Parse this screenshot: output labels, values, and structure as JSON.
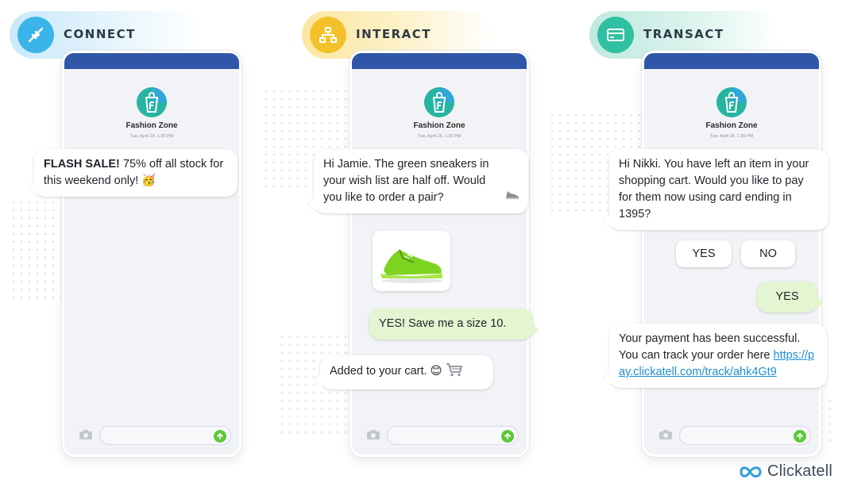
{
  "colors": {
    "connect": "#3bb4ea",
    "interact": "#f3c22b",
    "transact": "#2fc0a3",
    "phone_header": "#2f56a8",
    "outgoing": "#e4f5d1",
    "link": "#1f8fd0",
    "send": "#5dc93a"
  },
  "brand": {
    "name": "Fashion Zone",
    "timestamp": "Tue, April 18, 1.30 PM"
  },
  "panels": [
    {
      "phase": "CONNECT",
      "icon": "plug-icon",
      "messages": {
        "flash_bold": "FLASH SALE!",
        "flash_text": " 75% off all stock for this weekend only! ",
        "flash_emoji": "🥳"
      }
    },
    {
      "phase": "INTERACT",
      "icon": "network-icon",
      "messages": {
        "greeting": "Hi Jamie. The green sneakers in your wish list are half off. Would you like to order a pair?",
        "reply": "YES! Save me a size 10.",
        "confirm": "Added to your cart.",
        "confirm_emoji": "😊"
      }
    },
    {
      "phase": "TRANSACT",
      "icon": "credit-card-icon",
      "messages": {
        "prompt": "Hi Nikki. You have left an item in your shopping cart. Would you like to pay for them now using card ending in 1395?",
        "quick_yes": "YES",
        "quick_no": "NO",
        "reply": "YES",
        "success": "Your payment has been successful. You can track your order here ",
        "link": "https://pay.clickatell.com/track/ahk4Gt9"
      }
    }
  ],
  "footer": {
    "company": "Clickatell"
  }
}
